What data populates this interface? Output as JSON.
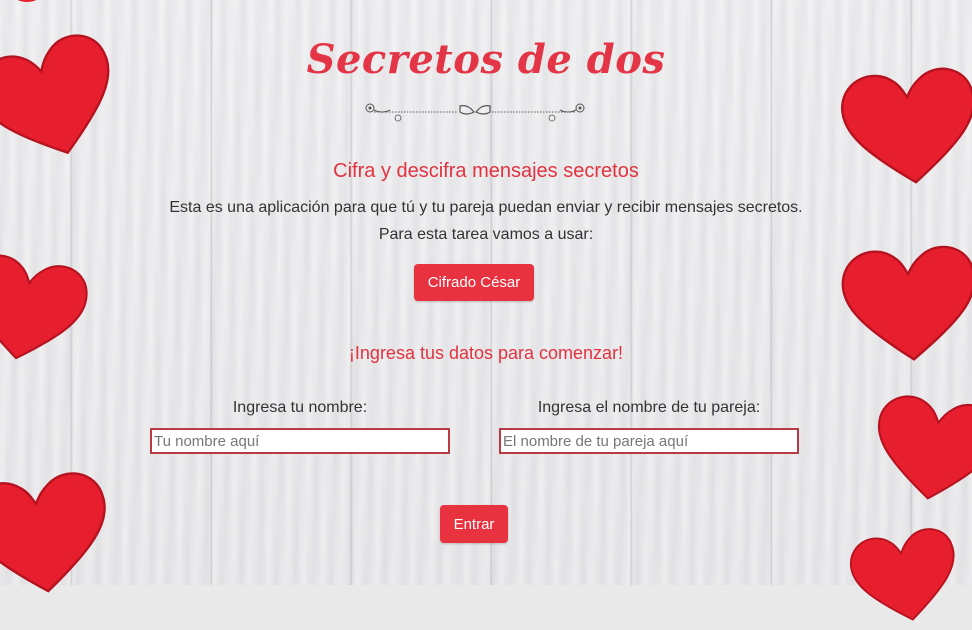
{
  "header": {
    "title": "Secretos de dos"
  },
  "intro": {
    "subtitle": "Cifra y descifra mensajes secretos",
    "line1": "Esta es una aplicación para que tú y tu pareja puedan enviar y recibir mensajes secretos.",
    "line2": "Para esta tarea vamos a usar:",
    "cipher_button": "Cifrado César"
  },
  "form": {
    "cta": "¡Ingresa tus datos para comenzar!",
    "name_label": "Ingresa tu nombre:",
    "name_placeholder": "Tu nombre aquí",
    "partner_label": "Ingresa el nombre de tu pareja:",
    "partner_placeholder": "El nombre de tu pareja aquí",
    "submit_label": "Entrar"
  },
  "colors": {
    "accent": "#e8323f",
    "heart": "#e8202f",
    "input_border": "#b73a45"
  },
  "decor": {
    "background": "white-wood-planks",
    "hearts": [
      "heart-icon",
      "heart-icon",
      "heart-icon",
      "heart-icon",
      "heart-icon",
      "heart-icon",
      "heart-icon",
      "heart-icon"
    ]
  }
}
